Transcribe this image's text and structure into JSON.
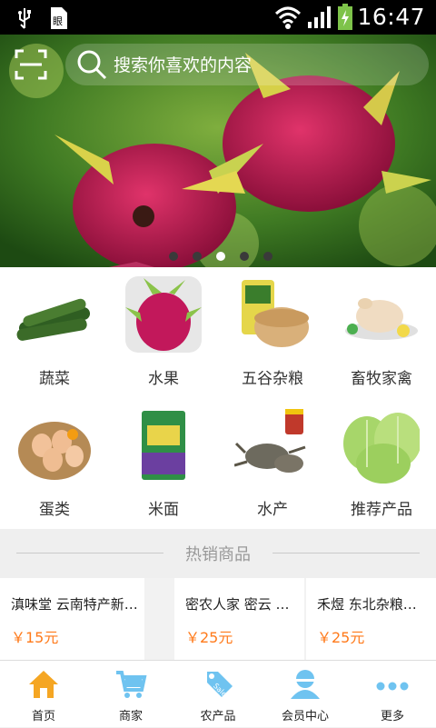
{
  "status": {
    "time": "16:47"
  },
  "header": {
    "search_placeholder": "搜索你喜欢的内容"
  },
  "banner": {
    "slides": 5,
    "active_slide": 3
  },
  "categories": [
    {
      "label": "蔬菜"
    },
    {
      "label": "水果"
    },
    {
      "label": "五谷杂粮"
    },
    {
      "label": "畜牧家禽"
    },
    {
      "label": "蛋类"
    },
    {
      "label": "米面"
    },
    {
      "label": "水产"
    },
    {
      "label": "推荐产品"
    }
  ],
  "hot": {
    "title": "热销商品",
    "products": [
      {
        "name": "滇味堂 云南特产新鲜…",
        "price": "￥15元"
      },
      {
        "name": "密农人家 密云 …",
        "price": "￥25元"
      },
      {
        "name": "禾煜 东北杂粮…",
        "price": "￥25元"
      }
    ]
  },
  "tabs": [
    {
      "label": "首页",
      "icon": "home-icon"
    },
    {
      "label": "商家",
      "icon": "cart-icon"
    },
    {
      "label": "农产品",
      "icon": "sale-tag-icon"
    },
    {
      "label": "会员中心",
      "icon": "user-icon"
    },
    {
      "label": "更多",
      "icon": "more-icon"
    }
  ],
  "colors": {
    "accent": "#ff7a1a",
    "tab_icon": "#6fc3f0",
    "home_icon": "#f5a623"
  }
}
